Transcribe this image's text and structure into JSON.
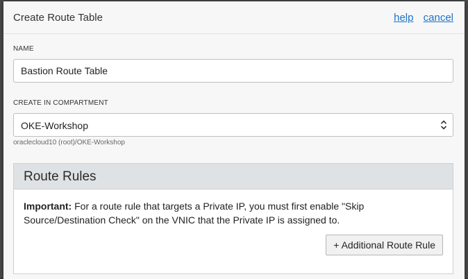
{
  "dialog": {
    "title": "Create Route Table",
    "help_label": "help",
    "cancel_label": "cancel"
  },
  "name_field": {
    "label": "NAME",
    "value": "Bastion Route Table"
  },
  "compartment_field": {
    "label": "CREATE IN COMPARTMENT",
    "selected": "OKE-Workshop",
    "path": "oraclecloud10 (root)/OKE-Workshop"
  },
  "route_rules": {
    "title": "Route Rules",
    "important_label": "Important:",
    "message": "For a route rule that targets a Private IP, you must first enable \"Skip Source/Destination Check\" on the VNIC that the Private IP is assigned to.",
    "add_button_label": "+ Additional Route Rule"
  },
  "colors": {
    "link": "#1a73c8",
    "section_header_bg": "#dfe2e4",
    "dialog_bg": "#f7f7f7"
  },
  "icons": {
    "select_chevron": "chevron-up-down-icon"
  }
}
